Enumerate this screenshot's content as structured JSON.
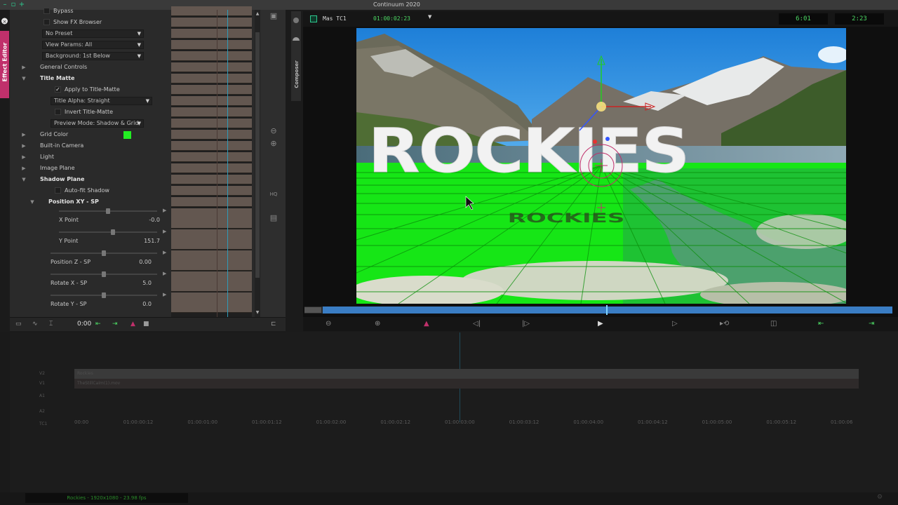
{
  "window": {
    "title": "Continuum 2020",
    "left_tab_label": "Effect Editor"
  },
  "effect_editor": {
    "rows": [
      {
        "type": "checkbox",
        "label": "Bypass",
        "checked": false,
        "indent": 1
      },
      {
        "type": "checkbox",
        "label": "Show FX Browser",
        "checked": false,
        "indent": 1
      },
      {
        "type": "dropdown",
        "label": "No Preset"
      },
      {
        "type": "dropdown",
        "label": "View Params: All"
      },
      {
        "type": "dropdown",
        "label": "Background: 1st Below"
      },
      {
        "type": "group",
        "label": "General Controls",
        "expanded": false
      },
      {
        "type": "group",
        "label": "Title Matte",
        "expanded": true
      },
      {
        "type": "checkbox",
        "label": "Apply to Title-Matte",
        "checked": true,
        "indent": 2
      },
      {
        "type": "dropdown2",
        "label": "Title Alpha: Straight"
      },
      {
        "type": "checkbox",
        "label": "Invert Title-Matte",
        "checked": false,
        "indent": 2
      },
      {
        "type": "dropdown2",
        "label": "Preview Mode: Shadow & Grid"
      },
      {
        "type": "group",
        "label": "Grid Color",
        "expanded": false,
        "swatch": "#22ee22"
      },
      {
        "type": "group",
        "label": "Built-in Camera",
        "expanded": false
      },
      {
        "type": "group",
        "label": "Light",
        "expanded": false
      },
      {
        "type": "group",
        "label": "Image Plane",
        "expanded": false
      },
      {
        "type": "group",
        "label": "Shadow Plane",
        "expanded": true
      },
      {
        "type": "checkbox",
        "label": "Auto-fit Shadow",
        "checked": false,
        "indent": 2
      },
      {
        "type": "subgroup",
        "label": "Position XY - SP",
        "expanded": true
      }
    ],
    "params": [
      {
        "label": "X Point",
        "value": "-0.0",
        "slider_fraction": 0.5
      },
      {
        "label": "Y Point",
        "value": "151.7",
        "slider_fraction": 0.55
      },
      {
        "label": "Position Z - SP",
        "value": "0.00",
        "slider_fraction": 0.5
      },
      {
        "label": "Rotate X - SP",
        "value": "5.0",
        "slider_fraction": 0.5
      },
      {
        "label": "Rotate Y - SP",
        "value": "0.0",
        "slider_fraction": 0.5
      }
    ],
    "bottom_time": "0:00"
  },
  "composer": {
    "tab_label": "Composer",
    "monitor_name": "Mas TC1",
    "monitor_timecode": "01:00:02:23",
    "tc_box_1": "6:01",
    "tc_box_2": "2:23",
    "title_text": "ROCKIES",
    "playhead_fraction": 0.52
  },
  "timeline": {
    "tracks": [
      {
        "label": "V2",
        "clip": "Rockies"
      },
      {
        "label": "V1",
        "clip": "TheStillCalm(1).mov"
      },
      {
        "label": "A1",
        "clip": ""
      },
      {
        "label": "A2",
        "clip": ""
      },
      {
        "label": "TC1",
        "clip": ""
      }
    ],
    "ruler_ticks": [
      "00:00",
      "01:00:00:12",
      "01:00:01:00",
      "01:00:01:12",
      "01:00:02:00",
      "01:00:02:12",
      "01:00:03:00",
      "01:00:03:12",
      "01:00:04:00",
      "01:00:04:12",
      "01:00:05:00",
      "01:00:05:12",
      "01:00:06"
    ],
    "status": "Rockies - 1920x1080 - 23.98 fps"
  },
  "colors": {
    "accent_pink": "#c0306b",
    "grid_green": "#22ee22",
    "timecode_green": "#4cd964",
    "playbar_blue": "#3a7dc4"
  }
}
